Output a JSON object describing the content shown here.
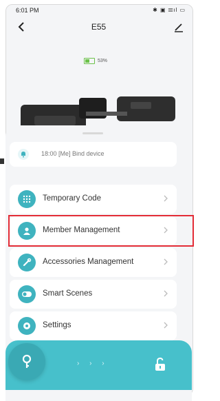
{
  "status": {
    "time": "6:01 PM",
    "icons": "✱ ▣ 𝄙ıl ▭"
  },
  "header": {
    "title": "E55"
  },
  "device": {
    "battery_percent": 53,
    "battery_text": "53%"
  },
  "notice": {
    "text": "18:00  [Me]  Bind device"
  },
  "menu": [
    {
      "label": "Temporary Code",
      "icon": "grid-icon"
    },
    {
      "label": "Member Management",
      "icon": "user-icon"
    },
    {
      "label": "Accessories Management",
      "icon": "wrench-icon"
    },
    {
      "label": "Smart Scenes",
      "icon": "toggle-icon"
    },
    {
      "label": "Settings",
      "icon": "gear-icon"
    }
  ],
  "unlock": {
    "arrows": "› › ›"
  },
  "colors": {
    "accent": "#47c0cb",
    "icon_bg": "#3fb3bf",
    "highlight": "#e32c36",
    "battery": "#6cc24a"
  }
}
